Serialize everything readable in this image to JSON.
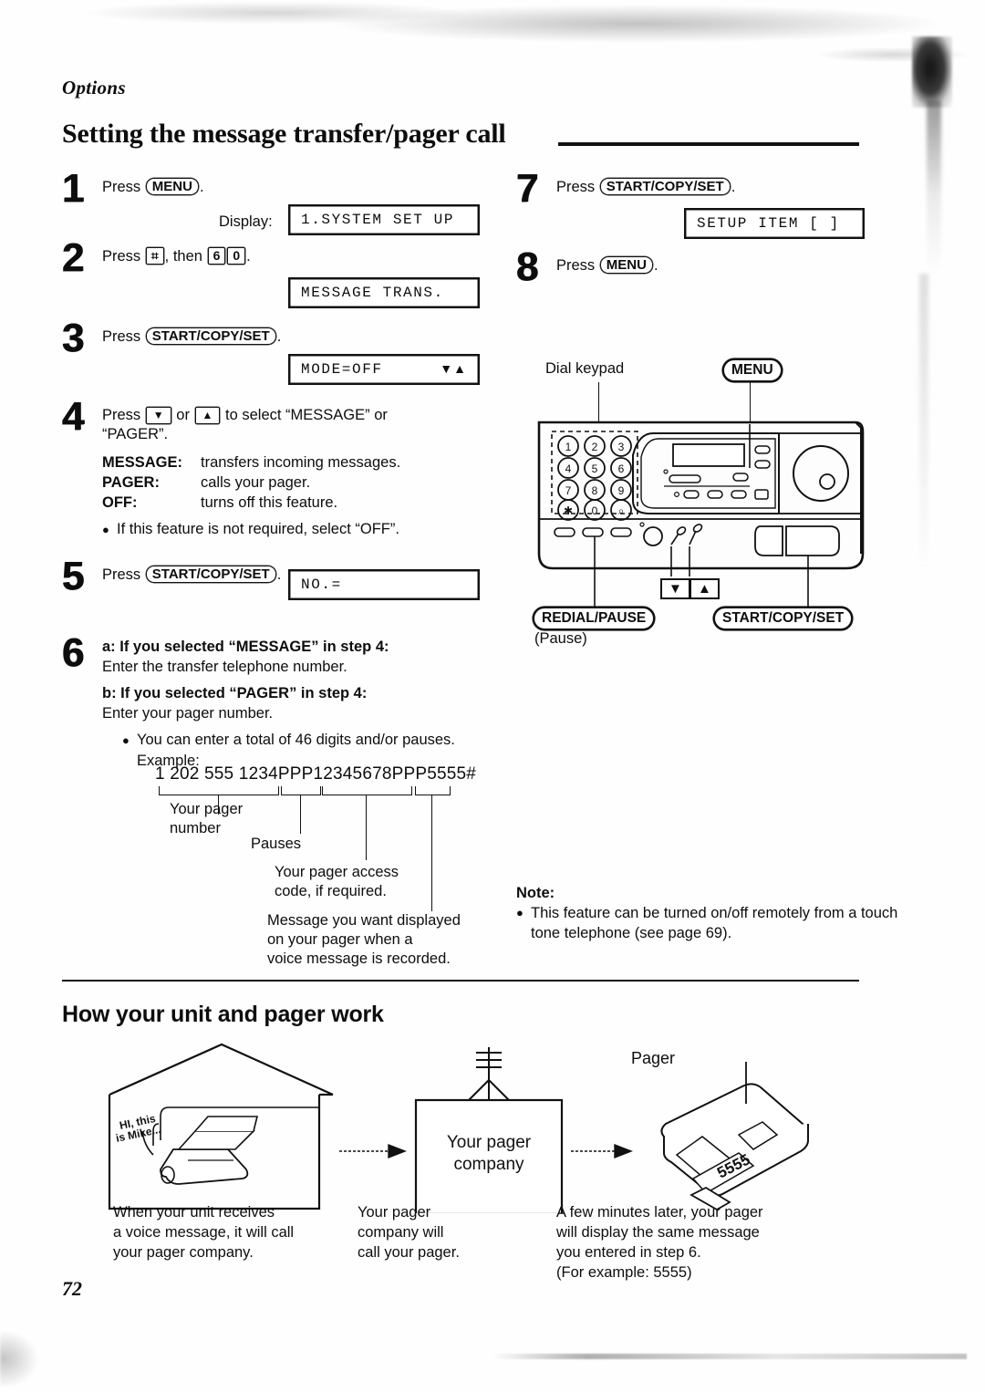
{
  "header": {
    "section": "Options",
    "title": "Setting the message transfer/pager call",
    "page_number": "72"
  },
  "steps": [
    {
      "num": "1",
      "press_label": "Press",
      "key": "MENU",
      "trailing": ".",
      "display_label": "Display:",
      "lcd": "1.SYSTEM SET UP"
    },
    {
      "num": "2",
      "press_label": "Press",
      "key1": "⌗",
      "mid": ", then",
      "key2": "6",
      "key3": "0",
      "trailing": ".",
      "lcd": "MESSAGE TRANS."
    },
    {
      "num": "3",
      "press_label": "Press",
      "key": "START/COPY/SET",
      "trailing": ".",
      "lcd": "MODE=OFF",
      "lcd_arrows": "▼▲"
    },
    {
      "num": "4",
      "press_label": "Press",
      "key1": "▼",
      "or": "or",
      "key2": "▲",
      "tail": "to select “MESSAGE” or",
      "tail2": "“PAGER”.",
      "definitions": [
        {
          "term": "MESSAGE:",
          "desc": "transfers incoming messages."
        },
        {
          "term": "PAGER:",
          "desc": "calls your pager."
        },
        {
          "term": "OFF:",
          "desc": "turns off this feature."
        }
      ],
      "bullet": "If this feature is not required, select “OFF”."
    },
    {
      "num": "5",
      "press_label": "Press",
      "key": "START/COPY/SET",
      "trailing": ".",
      "lcd": "NO.="
    },
    {
      "num": "6",
      "case_a_title": "a: If you selected “MESSAGE” in step 4:",
      "case_a_text": "Enter the transfer telephone number.",
      "case_b_title": "b: If you selected “PAGER” in step 4:",
      "case_b_text": "Enter your pager number.",
      "bullet": "You can enter a total of 46 digits and/or pauses.",
      "example_label": "Example:",
      "example_number": "1 202 555 1234PPP12345678PPP5555#",
      "callouts": [
        "Your pager\nnumber",
        "Pauses",
        "Your pager access\ncode, if required.",
        "Message you want displayed\non your pager when a\nvoice message is recorded."
      ]
    },
    {
      "num": "7",
      "press_label": "Press",
      "key": "START/COPY/SET",
      "trailing": ".",
      "lcd": "SETUP ITEM [   ]"
    },
    {
      "num": "8",
      "press_label": "Press",
      "key": "MENU",
      "trailing": "."
    }
  ],
  "machine_diagram": {
    "dial_keypad_label": "Dial keypad",
    "menu_label": "MENU",
    "redial_label": "REDIAL/PAUSE",
    "pause_label": "(Pause)",
    "start_label": "START/COPY/SET",
    "down_key": "▼",
    "up_key": "▲",
    "keypad_keys": [
      "1",
      "2",
      "3",
      "4",
      "5",
      "6",
      "7",
      "8",
      "9",
      "✱",
      "0",
      "⌗"
    ]
  },
  "note": {
    "title": "Note:",
    "bullet": "This feature can be turned on/off remotely from a touch tone telephone (see page 69)."
  },
  "how_it_works": {
    "heading": "How your unit and pager work",
    "speech_line1": "HI, this",
    "speech_line2": "is Mike...",
    "pager_company_line1": "Your pager",
    "pager_company_line2": "company",
    "pager_label": "Pager",
    "pager_display": "5555",
    "captions": [
      "When your unit receives\na voice message, it will call\nyour pager company.",
      "Your pager\ncompany will\ncall your pager.",
      "A few minutes later, your pager\nwill display the same message\nyou entered in step 6.\n(For example: 5555)"
    ]
  },
  "colors": {
    "ink": "#0d0d0d",
    "paper": "#fefefe"
  }
}
